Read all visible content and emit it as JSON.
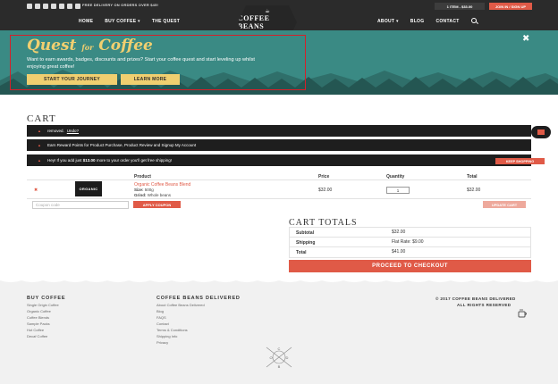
{
  "topbar": {
    "promo": "FREE DELIVERY ON ORDERS OVER $45!",
    "cart": "1 ITEM - $33.00",
    "login": "JOIN IN / SIGN UP",
    "nav_left": [
      "HOME",
      "BUY COFFEE ▾",
      "THE QUEST"
    ],
    "nav_right": [
      "ABOUT ▾",
      "BLOG",
      "CONTACT"
    ],
    "logo_main": "COFFEE BEANS",
    "logo_sub": "DELIVERED",
    "logo_cup": "☕",
    "socials": [
      "facebook-icon",
      "twitter-icon",
      "instagram-icon",
      "pinterest-icon",
      "google-icon",
      "youtube-icon",
      "email-icon"
    ]
  },
  "hero": {
    "title_a": "Quest",
    "title_for": "for",
    "title_b": "Coffee",
    "text": "Want to earn awards, badges, discounts and prizes? Start your coffee quest and start leveling up whilst enjoying great coffee!",
    "btn_journey": "START YOUR JOURNEY",
    "btn_learn": "LEARN MORE",
    "close": "✖"
  },
  "cart": {
    "heading": "CART",
    "notice_removed": "removed.",
    "notice_undo": "Undo?",
    "notice_rewards": "Earn Reward Points for Product Purchase, Product Review and Signup My Account",
    "notice_shipping_a": "Hey! If you add just",
    "notice_shipping_amount": "$13.00",
    "notice_shipping_b": "more to your order you'll get free shipping!",
    "btn_keep": "KEEP SHOPPING",
    "columns": [
      "Product",
      "Price",
      "Quantity",
      "Total"
    ],
    "item": {
      "thumb": "ORGANIC",
      "name": "Organic Coffee Beans Blend",
      "size_label": "Size:",
      "size": "500g",
      "grind_label": "Grind:",
      "grind": "Whole beans",
      "price": "$32.00",
      "qty": "1",
      "total": "$32.00",
      "remove": "✖"
    },
    "coupon_placeholder": "Coupon code",
    "btn_apply": "APPLY COUPON",
    "btn_update": "UPDATE CART"
  },
  "totals": {
    "heading": "CART TOTALS",
    "rows": [
      {
        "label": "Subtotal",
        "value": "$32.00"
      },
      {
        "label": "Shipping",
        "value": "Flat Rate: $9.00"
      },
      {
        "label": "Total",
        "value": "$41.00"
      }
    ],
    "checkout": "PROCEED TO CHECKOUT"
  },
  "footer": {
    "col1_head": "BUY COFFEE",
    "col1": [
      "Single Origin Coffee",
      "Organic Coffee",
      "Coffee Blends",
      "Sample Packs",
      "Hot Coffee",
      "Decaf Coffee"
    ],
    "col2_head": "COFFEE BEANS DELIVERED",
    "col2": [
      "About Coffee Beans Delivered",
      "Blog",
      "FAQS",
      "Contact",
      "Terms & Conditions",
      "Shipping Info",
      "Privacy"
    ],
    "copyright": "© 2017 COFFEE BEANS DELIVERED",
    "rights": "ALL RIGHTS RESERVED",
    "compass": [
      "C",
      "O",
      "D",
      "B"
    ]
  },
  "colors": {
    "accent": "#e05a47",
    "hero_bg": "#3a8a84",
    "hero_gold": "#f0cf70",
    "dark": "#1e1e1e"
  }
}
